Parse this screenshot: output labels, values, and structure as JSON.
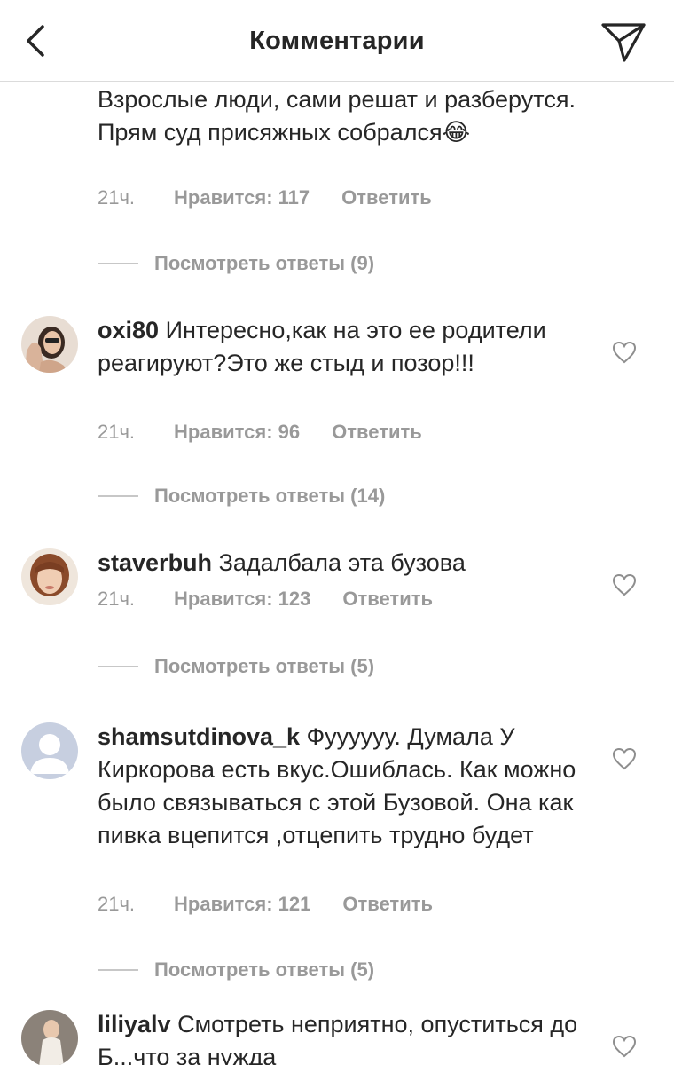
{
  "header": {
    "title": "Комментарии"
  },
  "continued_comment": {
    "text": "Взрослые люди, сами решат и разберутся. Прям суд присяжных собрался😂",
    "time": "21ч.",
    "likes": "Нравится: 117",
    "reply": "Ответить",
    "view_replies": "Посмотреть ответы (9)"
  },
  "comments": [
    {
      "username": "oxi80",
      "text": "Интересно,как на это ее родители реагируют?Это же стыд и позор!!!",
      "time": "21ч.",
      "likes": "Нравится: 96",
      "reply": "Ответить",
      "view_replies": "Посмотреть ответы (14)"
    },
    {
      "username": "staverbuh",
      "text": "Задалбала эта бузова",
      "time": "21ч.",
      "likes": "Нравится: 123",
      "reply": "Ответить",
      "view_replies": "Посмотреть ответы (5)"
    },
    {
      "username": "shamsutdinova_k",
      "text": "Фуууууу. Думала  У Киркорова есть вкус.Ошиблась. Как можно было связываться  с этой Бузовой. Она как пивка вцепится ,отцепить  трудно будет",
      "time": "21ч.",
      "likes": "Нравится: 121",
      "reply": "Ответить",
      "view_replies": "Посмотреть ответы (5)"
    },
    {
      "username": "liliyalv",
      "text": "Смотреть неприятно, опуститься до Б...что за нужда"
    }
  ],
  "icons": {
    "back": "chevron-left-icon",
    "share": "paper-plane-icon",
    "like": "heart-outline-icon"
  },
  "colors": {
    "text": "#262626",
    "secondary": "#999999",
    "divider": "#dbdbdb"
  }
}
